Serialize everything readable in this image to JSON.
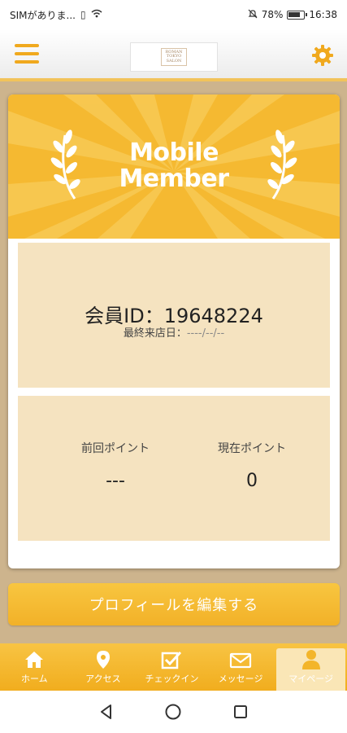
{
  "status_bar": {
    "carrier": "SIMがありま...",
    "battery": "78%",
    "time": "16:38"
  },
  "header": {
    "logo_text": "ROMAN TOKYO SALON",
    "menu_icon": "hamburger-icon",
    "settings_icon": "gear-icon"
  },
  "banner": {
    "line1": "Mobile",
    "line2": "Member"
  },
  "member": {
    "id_label": "会員ID：19648224",
    "last_visit_label": "最終来店日：",
    "last_visit_value": "----/--/--"
  },
  "points": {
    "previous_label": "前回ポイント",
    "previous_value": "---",
    "current_label": "現在ポイント",
    "current_value": "0"
  },
  "edit_profile_label": "プロフィールを編集する",
  "tabs": [
    {
      "label": "ホーム",
      "icon": "home-icon"
    },
    {
      "label": "アクセス",
      "icon": "location-pin-icon"
    },
    {
      "label": "チェックイン",
      "icon": "checkin-icon"
    },
    {
      "label": "メッセージ",
      "icon": "mail-icon"
    },
    {
      "label": "マイページ",
      "icon": "person-icon"
    }
  ],
  "colors": {
    "accent": "#f5b931",
    "panel": "#f5e3c0",
    "background": "#cdb48d"
  }
}
